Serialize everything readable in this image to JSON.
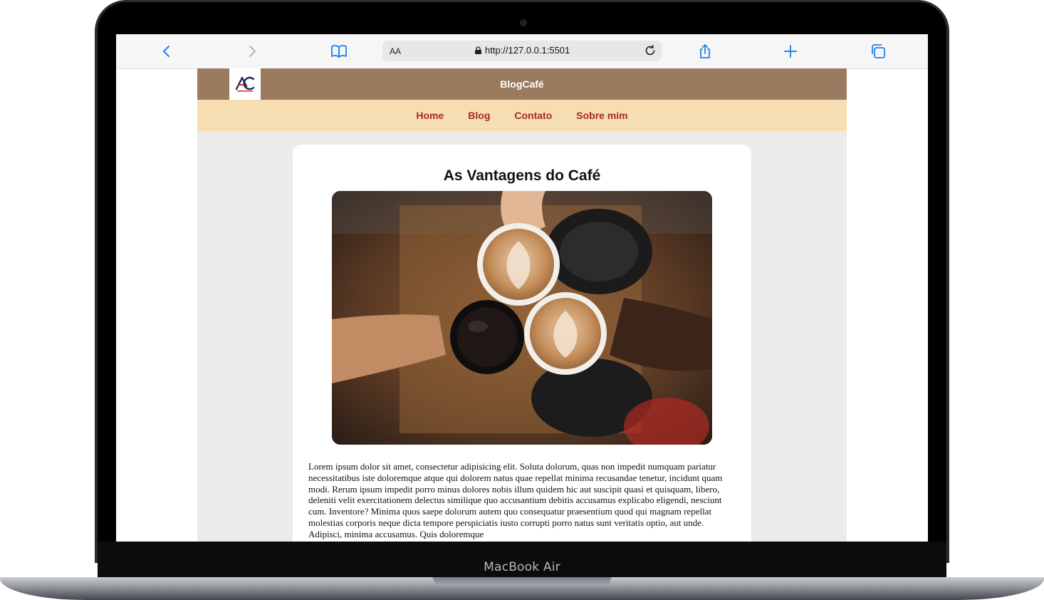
{
  "browser": {
    "address_text_size": "AA",
    "url": "http://127.0.0.1:5501"
  },
  "site": {
    "title": "BlogCafé",
    "nav": [
      "Home",
      "Blog",
      "Contato",
      "Sobre mim"
    ],
    "article": {
      "heading": "As Vantagens do Café",
      "body": "Lorem ipsum dolor sit amet, consectetur adipisicing elit. Soluta dolorum, quas non impedit numquam pariatur necessitatibus iste doloremque atque qui dolorem natus quae repellat minima recusandae tenetur, incidunt quam modi. Rerum ipsum impedit porro minus dolores nobis illum quidem hic aut suscipit quasi et quisquam, libero, deleniti velit exercitationem delectus similique quo accusantium debitis accusamus explicabo eligendi, nesciunt cum. Inventore? Minima quos saepe dolorum autem quo consequatur praesentium quod qui magnam repellat molestias corporis neque dicta tempore perspiciatis iusto corrupti porro natus sunt veritatis optio, aut unde. Adipisci, minima accusamus. Quis doloremque"
    }
  },
  "device": {
    "label": "MacBook Air"
  },
  "icons": {
    "back": "chevron-left-icon",
    "forward": "chevron-right-icon",
    "bookmarks": "book-icon",
    "lock": "lock-icon",
    "reload": "reload-icon",
    "share": "share-icon",
    "new_tab": "plus-icon",
    "tabs": "tabs-icon"
  },
  "colors": {
    "header": "#9b7b5f",
    "nav_bg": "#f6deb2",
    "nav_link": "#a52a2a",
    "accent": "#1a84f0"
  }
}
